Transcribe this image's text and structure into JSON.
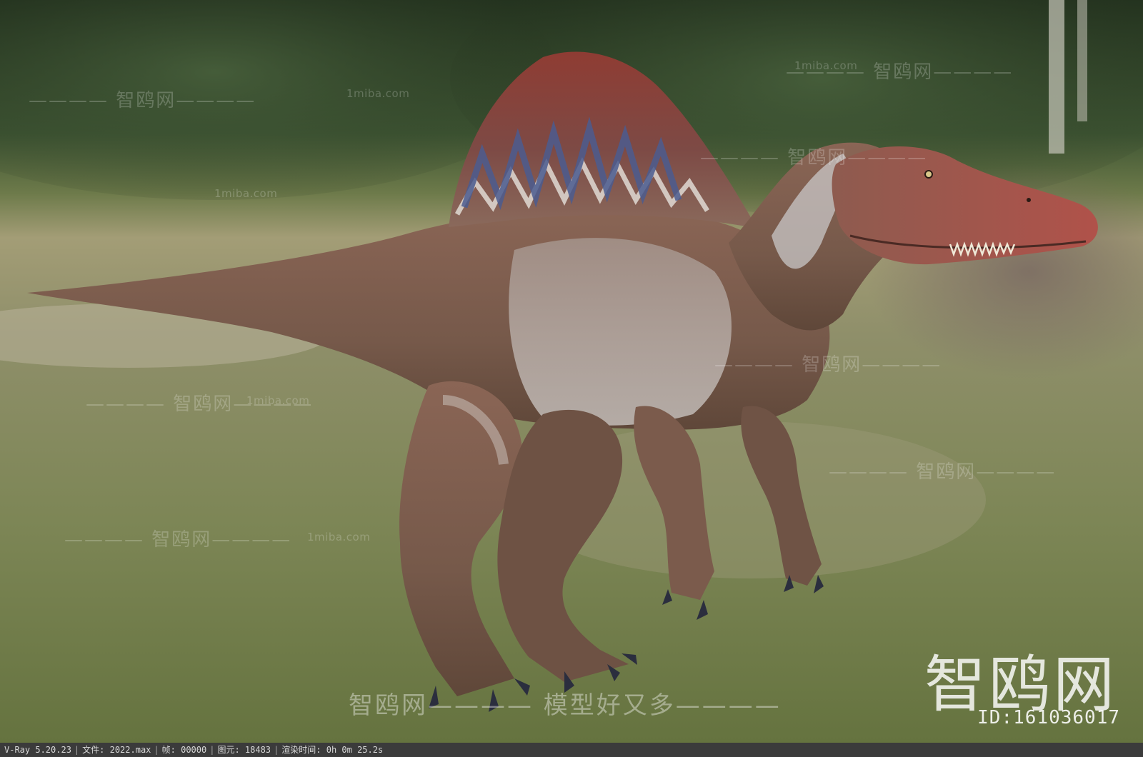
{
  "scene": {
    "subject": "spinosaurus-3d-render",
    "colors": {
      "sky_trees": "#2f4a2a",
      "ground": "#8c8c6a",
      "skin": "#7a5c4e",
      "sail_red": "#8e3b33",
      "sail_blue": "#4d5f8f",
      "belly": "#c9c6c4"
    }
  },
  "watermarks": {
    "brand": "智鸥网",
    "slogan": "智鸥网———— 模型好又多————",
    "repeat": "———— 智鸥网————",
    "site": "1miba.com",
    "site_repeat": "1miba.com",
    "id": "ID:161036017"
  },
  "status_bar": {
    "renderer": "V-Ray 5.20.23",
    "file": "文件: 2022.max",
    "frame": "帧: 00000",
    "primitives": "图元: 18483",
    "render_time": "渲染时间:  0h  0m 25.2s"
  }
}
